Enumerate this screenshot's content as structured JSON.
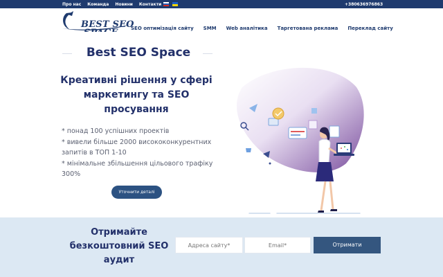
{
  "topbar": {
    "links": [
      "Про нас",
      "Команда",
      "Новини",
      "Контакти"
    ],
    "phone": "+380636976863",
    "bg_color": "#1e3a6e"
  },
  "header": {
    "logo_line1": "BEST SEO",
    "logo_line2": "SPACE",
    "nav": [
      "SEO оптимізація сайту",
      "SMM",
      "Web аналітика",
      "Таргетована реклама",
      "Переклад сайту"
    ]
  },
  "hero": {
    "title": "Best SEO Space",
    "subtitle": "Креативні рішення у сфері маркетингу та SEO просування",
    "bullets": [
      "* понад 100 успішних проектів",
      "* вивели більше 2000 висококонкурентних запитів в ТОП 1-10",
      "* мінімальне збільшення цільового трафіку 300%"
    ],
    "cta_label": "Уточнити деталі",
    "accent_color": "#2c5282"
  },
  "audit": {
    "title": "Отримайте безкоштовний SEO аудит",
    "site_placeholder": "Адреса сайту*",
    "email_placeholder": "Email*",
    "submit_label": "Отримати",
    "bg_color": "#dce8f3"
  }
}
